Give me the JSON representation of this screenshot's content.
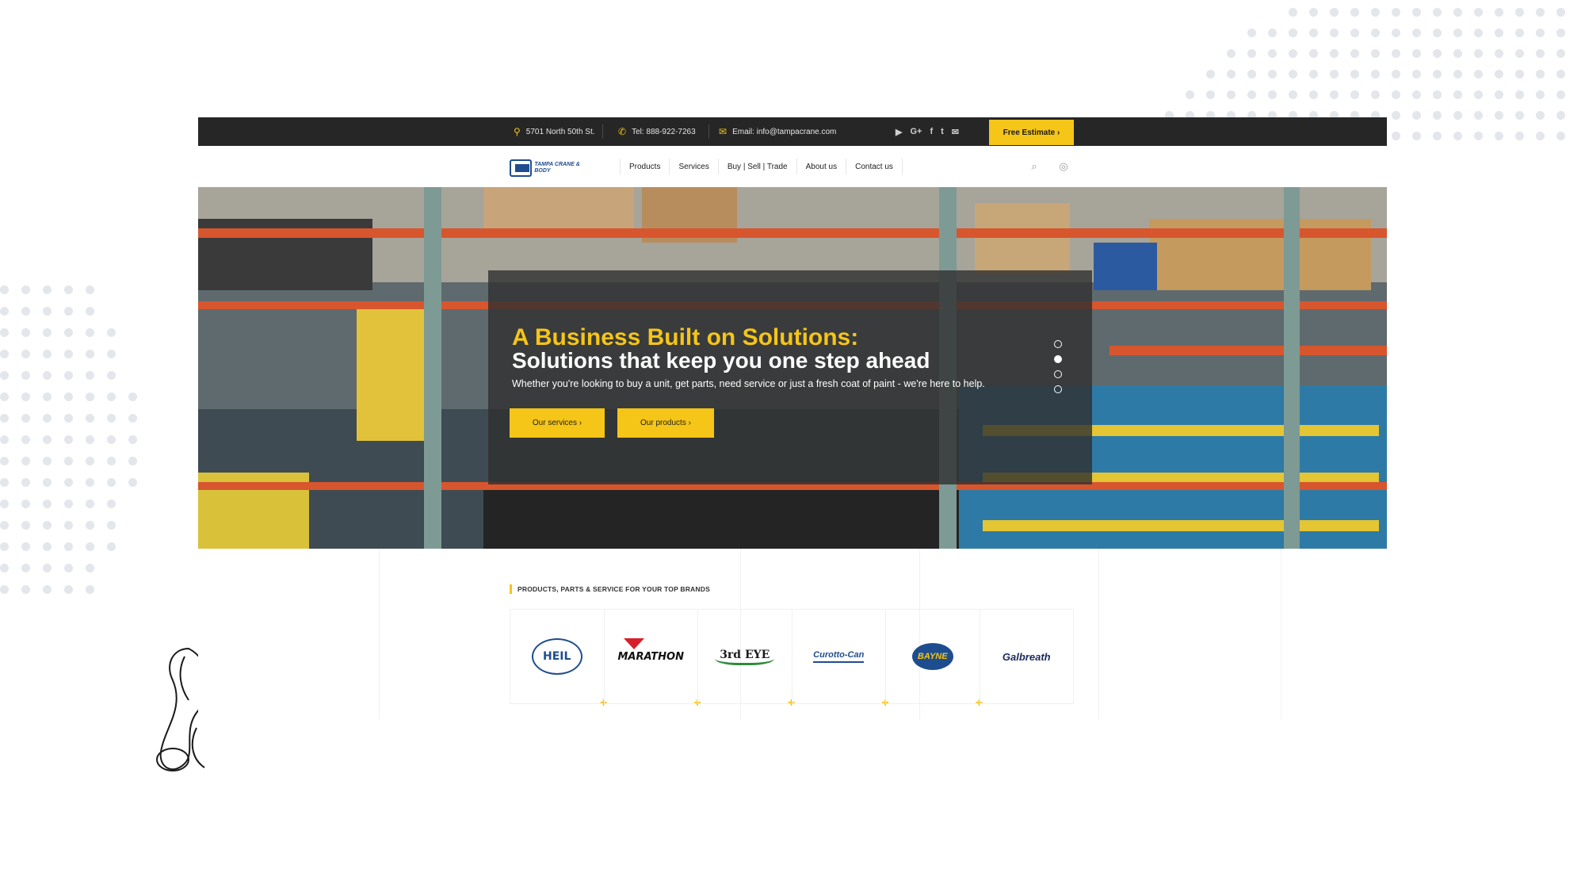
{
  "topbar": {
    "address": "5701 North 50th St.",
    "phone": "Tel: 888-922-7263",
    "email": "Email: info@tampacrane.com",
    "social": [
      "youtube-icon",
      "google-plus-icon",
      "facebook-icon",
      "twitter-icon",
      "mail-icon"
    ],
    "social_glyphs": [
      "▶",
      "G+",
      "f",
      "t",
      "✉"
    ],
    "cta_label": "Free Estimate ›"
  },
  "nav": {
    "logo_text": "TAMPA CRANE & BODY",
    "menu": [
      "Products",
      "Services",
      "Buy | Sell | Trade",
      "About us",
      "Contact us"
    ],
    "icons": [
      "search-icon",
      "globe-icon"
    ]
  },
  "hero": {
    "title_line1": "A Business Built on Solutions:",
    "title_line2": "Solutions that keep you one step ahead",
    "subtitle": "Whether you're looking to buy a unit, get parts, need service or just a fresh coat of paint - we're here to help.",
    "button_services": "Our services  ›",
    "button_products": "Our products  ›",
    "slides_total": 4,
    "active_slide": 2
  },
  "brands": {
    "title": "PRODUCTS, PARTS & SERVICE FOR YOUR TOP BRANDS",
    "logos": [
      "HEIL",
      "MARATHON",
      "3rd EYE",
      "Curotto-Can",
      "BAYNE",
      "Galbreath"
    ]
  },
  "colors": {
    "accent": "#f5c518",
    "topbar_bg": "#262626",
    "brand_blue": "#1e4d8f"
  }
}
